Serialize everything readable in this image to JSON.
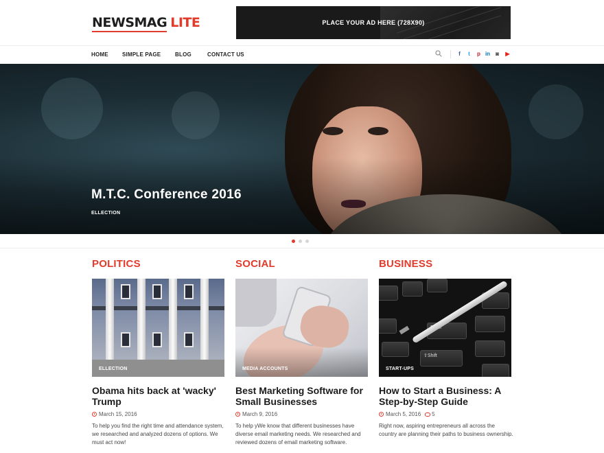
{
  "header": {
    "logo_dark": "NEWSMAG",
    "logo_red": "LITE",
    "ad_text": "PLACE YOUR AD HERE (728X90)"
  },
  "nav": {
    "items": [
      "HOME",
      "SIMPLE PAGE",
      "BLOG",
      "CONTACT US"
    ],
    "search_icon": "search-icon",
    "social": [
      {
        "name": "facebook-icon",
        "glyph": "f",
        "color": "#3b5998"
      },
      {
        "name": "twitter-icon",
        "glyph": "t",
        "color": "#1da1f2"
      },
      {
        "name": "pinterest-icon",
        "glyph": "p",
        "color": "#cb2027"
      },
      {
        "name": "linkedin-icon",
        "glyph": "in",
        "color": "#0077b5"
      },
      {
        "name": "instagram-icon",
        "glyph": "◙",
        "color": "#444444"
      },
      {
        "name": "youtube-icon",
        "glyph": "▶",
        "color": "#e62117"
      }
    ]
  },
  "hero": {
    "title": "M.T.C. Conference 2016",
    "category": "ELLECTION",
    "slides": 3,
    "active_slide": 1
  },
  "columns": [
    {
      "section": "POLITICS",
      "category": "ELLECTION",
      "title": "Obama hits back at 'wacky' Trump",
      "date": "March 15, 2016",
      "comments": "",
      "excerpt": "To help you find the right time and attendance system, we researched and analyzed dozens of options. We must act now!"
    },
    {
      "section": "SOCIAL",
      "category": "MEDIA ACCOUNTS",
      "title": "Best Marketing Software for Small Businesses",
      "date": "March 9, 2016",
      "comments": "",
      "excerpt": "To help yWe know that different businesses have diverse email marketing needs. We researched and reviewed dozens of email marketing software."
    },
    {
      "section": "BUSINESS",
      "category": "START-UPS",
      "title": "How to Start a Business: A Step-by-Step Guide",
      "date": "March 5, 2016",
      "comments": "5",
      "excerpt": "Right now, aspiring entrepreneurs all across the country are planning their paths to business ownership."
    }
  ],
  "colors": {
    "accent": "#e23a2b",
    "text": "#1b1b1b"
  }
}
